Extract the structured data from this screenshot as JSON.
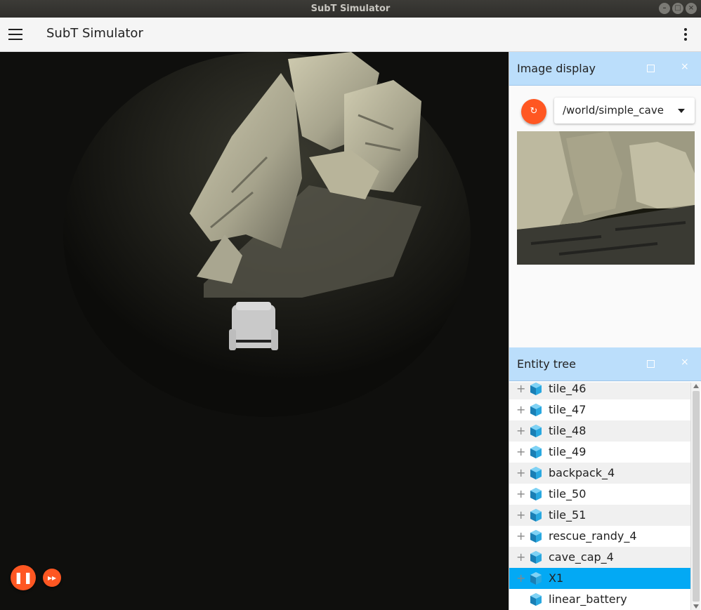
{
  "window": {
    "title": "SubT Simulator"
  },
  "appbar": {
    "title": "SubT Simulator",
    "menu_icon": "hamburger-icon",
    "more_icon": "more-vert-icon"
  },
  "scene": {
    "controls": {
      "play_icon": "pause-icon",
      "step_icon": "fast-forward-icon",
      "play_glyph": "❚❚",
      "step_glyph": "▸▸"
    }
  },
  "image_display": {
    "title": "Image display",
    "topic": "/world/simple_cave",
    "refresh_icon": "refresh-icon",
    "refresh_glyph": "↻",
    "close_glyph": "×"
  },
  "entity_tree": {
    "title": "Entity tree",
    "close_glyph": "×",
    "items": [
      {
        "label": "tile_46",
        "expandable": true
      },
      {
        "label": "tile_47",
        "expandable": true
      },
      {
        "label": "tile_48",
        "expandable": true
      },
      {
        "label": "tile_49",
        "expandable": true
      },
      {
        "label": "backpack_4",
        "expandable": true
      },
      {
        "label": "tile_50",
        "expandable": true
      },
      {
        "label": "tile_51",
        "expandable": true
      },
      {
        "label": "rescue_randy_4",
        "expandable": true
      },
      {
        "label": "cave_cap_4",
        "expandable": true
      },
      {
        "label": "X1",
        "expandable": true,
        "selected": true
      },
      {
        "label": "linear_battery",
        "expandable": false
      }
    ]
  },
  "colors": {
    "accent": "#ff5722",
    "panel_header": "#bbdefb",
    "selection": "#03a9f4",
    "cube_icon": "#29a8e0"
  }
}
